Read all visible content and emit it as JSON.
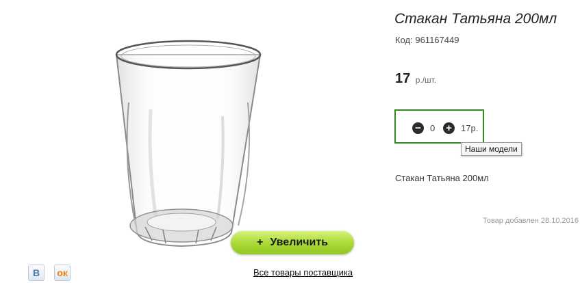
{
  "product": {
    "title": "Стакан Татьяна 200мл",
    "sku_label": "Код:",
    "sku": "961167449",
    "price_value": "17",
    "price_unit": "р./шт.",
    "description": "Стакан Татьяна 200мл",
    "added_text": "Товар добавлен 28.10.2016"
  },
  "cart": {
    "minus_symbol": "−",
    "plus_symbol": "+",
    "quantity": "0",
    "sum": "17р."
  },
  "tooltip": {
    "text": "Наши модели"
  },
  "zoom": {
    "plus": "+",
    "label": "Увеличить"
  },
  "share": {
    "vk": "В",
    "ok": "ок"
  },
  "supplier_link": "Все товары поставщика",
  "colors": {
    "cart_border": "#2e8b1c",
    "zoom_button": "#a9d935"
  }
}
